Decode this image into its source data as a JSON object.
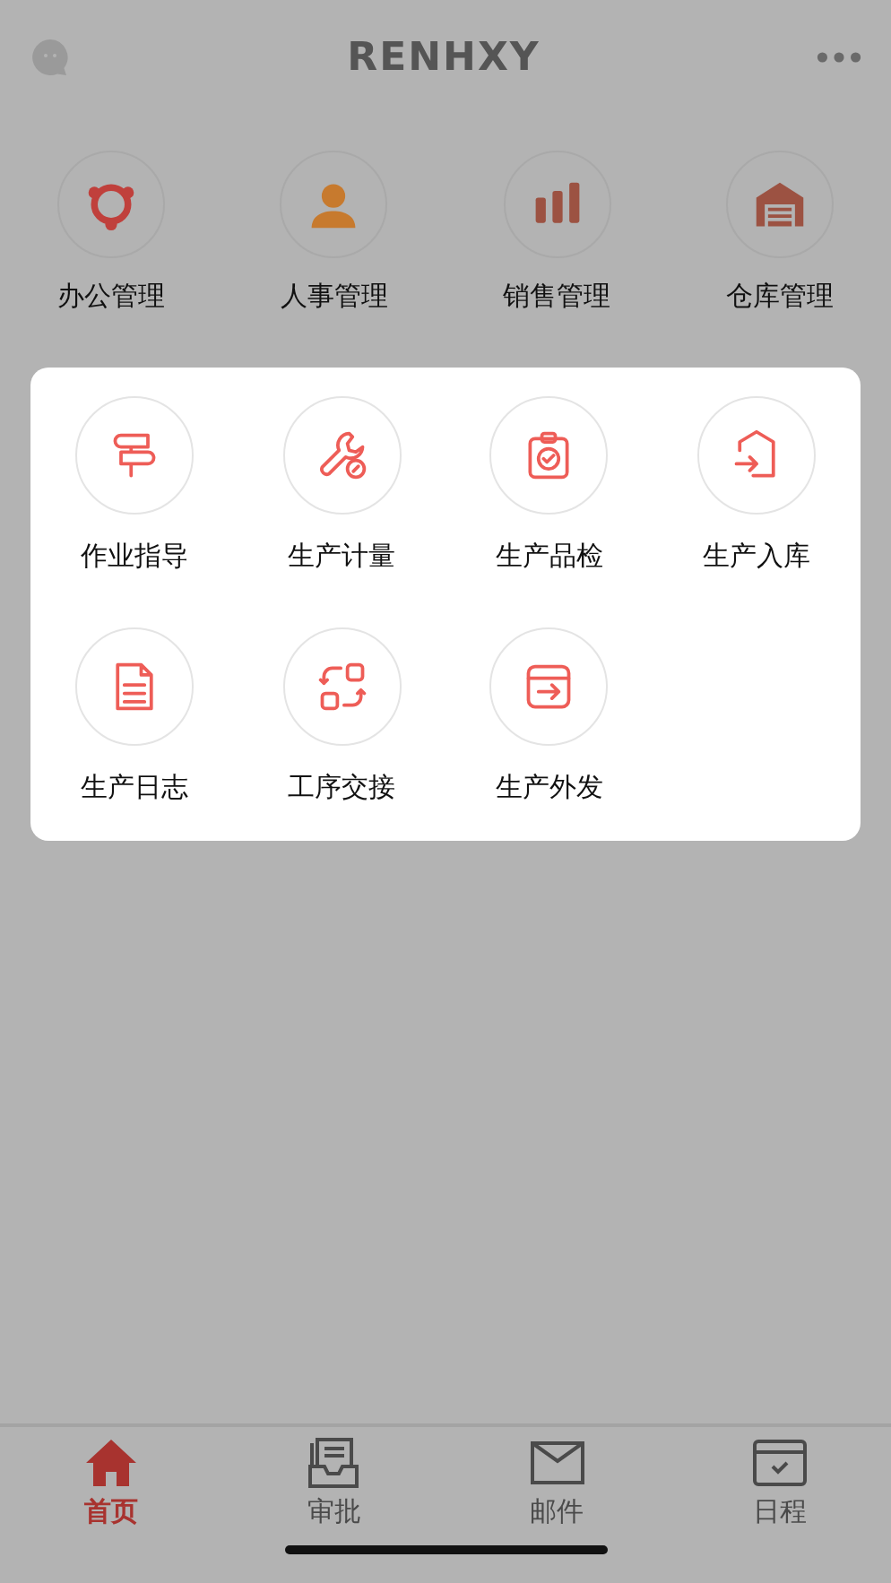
{
  "header": {
    "title": "RENHXY"
  },
  "modules": [
    {
      "label": "办公管理",
      "kind": "team"
    },
    {
      "label": "人事管理",
      "kind": "person"
    },
    {
      "label": "销售管理",
      "kind": "bars"
    },
    {
      "label": "仓库管理",
      "kind": "warehouse"
    }
  ],
  "popup": {
    "items": [
      {
        "label": "作业指导",
        "kind": "signpost"
      },
      {
        "label": "生产计量",
        "kind": "wrench"
      },
      {
        "label": "生产品检",
        "kind": "clipboard"
      },
      {
        "label": "生产入库",
        "kind": "inbound"
      },
      {
        "label": "生产日志",
        "kind": "document"
      },
      {
        "label": "工序交接",
        "kind": "swap"
      },
      {
        "label": "生产外发",
        "kind": "outbound"
      }
    ]
  },
  "tab_bar": [
    {
      "label": "首页",
      "kind": "home",
      "selected": true
    },
    {
      "label": "审批",
      "kind": "inbox",
      "selected": false
    },
    {
      "label": "邮件",
      "kind": "mail",
      "selected": false
    },
    {
      "label": "日程",
      "kind": "calendar",
      "selected": false
    }
  ]
}
